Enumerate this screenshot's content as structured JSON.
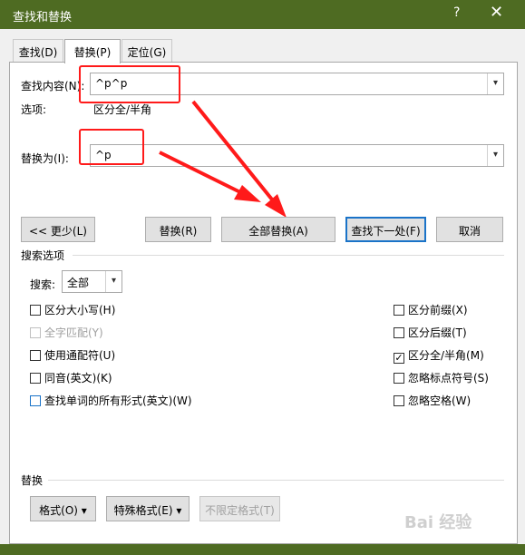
{
  "window": {
    "title": "查找和替换",
    "help": "?",
    "close": "✕"
  },
  "tabs": [
    {
      "label": "查找(D)"
    },
    {
      "label": "替换(P)"
    },
    {
      "label": "定位(G)"
    }
  ],
  "find": {
    "label": "查找内容(N):",
    "value": "^p^p"
  },
  "options": {
    "label": "选项:",
    "value": "区分全/半角"
  },
  "replace": {
    "label": "替换为(I):",
    "value": "^p"
  },
  "buttons": {
    "less": "<< 更少(L)",
    "replace": "替换(R)",
    "replace_all": "全部替换(A)",
    "find_next": "查找下一处(F)",
    "cancel": "取消"
  },
  "search_options": {
    "title": "搜索选项",
    "search_label": "搜索:",
    "search_value": "全部",
    "left": [
      {
        "label": "区分大小写(H)",
        "checked": false
      },
      {
        "label": "全字匹配(Y)",
        "checked": false
      },
      {
        "label": "使用通配符(U)",
        "checked": false
      },
      {
        "label": "同音(英文)(K)",
        "checked": false
      },
      {
        "label": "查找单词的所有形式(英文)(W)",
        "checked": false
      }
    ],
    "right": [
      {
        "label": "区分前缀(X)",
        "checked": false
      },
      {
        "label": "区分后缀(T)",
        "checked": false
      },
      {
        "label": "区分全/半角(M)",
        "checked": true,
        "mark": "✓"
      },
      {
        "label": "忽略标点符号(S)",
        "checked": false
      },
      {
        "label": "忽略空格(W)",
        "checked": false
      }
    ]
  },
  "replace_section": {
    "title": "替换",
    "format": "格式(O) ▾",
    "special": "特殊格式(E) ▾",
    "no_format": "不限定格式(T)"
  },
  "watermark": "Bai 经验",
  "colors": {
    "title_bar": "#4e6b22",
    "highlight": "#ff1a1a",
    "accent": "#1a73c8"
  }
}
